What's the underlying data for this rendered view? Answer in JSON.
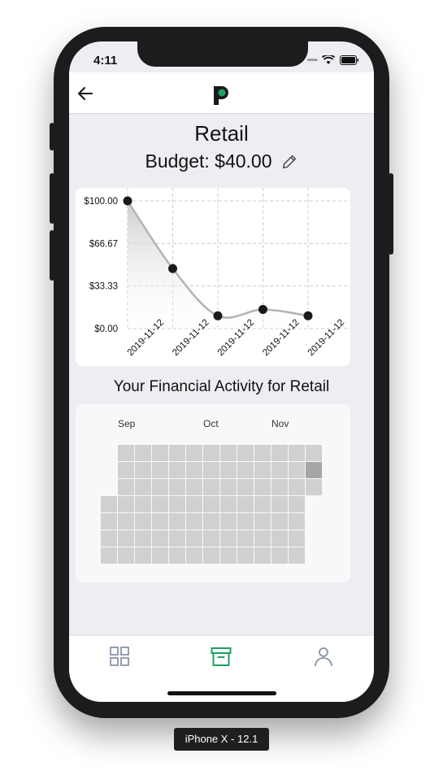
{
  "status_bar": {
    "time": "4:11"
  },
  "header": {
    "logo_letter": "P",
    "brand_color": "#1aa260"
  },
  "page": {
    "title": "Retail",
    "budget_label": "Budget: $40.00"
  },
  "chart_data": {
    "type": "line",
    "x": [
      "2019-11-12",
      "2019-11-12",
      "2019-11-12",
      "2019-11-12",
      "2019-11-12"
    ],
    "series": [
      {
        "values": [
          100,
          47,
          10,
          15,
          10
        ]
      }
    ],
    "yticks": [
      "$100.00",
      "$66.67",
      "$33.33",
      "$0.00"
    ],
    "ylim": [
      0,
      100
    ],
    "grid": true,
    "smooth": true,
    "fill": "gradient"
  },
  "activity": {
    "title": "Your Financial Activity for Retail",
    "months": [
      "Sep",
      "Oct",
      "Nov"
    ],
    "highlight_color": "#a5a6a8",
    "empty_color": "#cfd0d2"
  },
  "device_label": "iPhone X - 12.1"
}
